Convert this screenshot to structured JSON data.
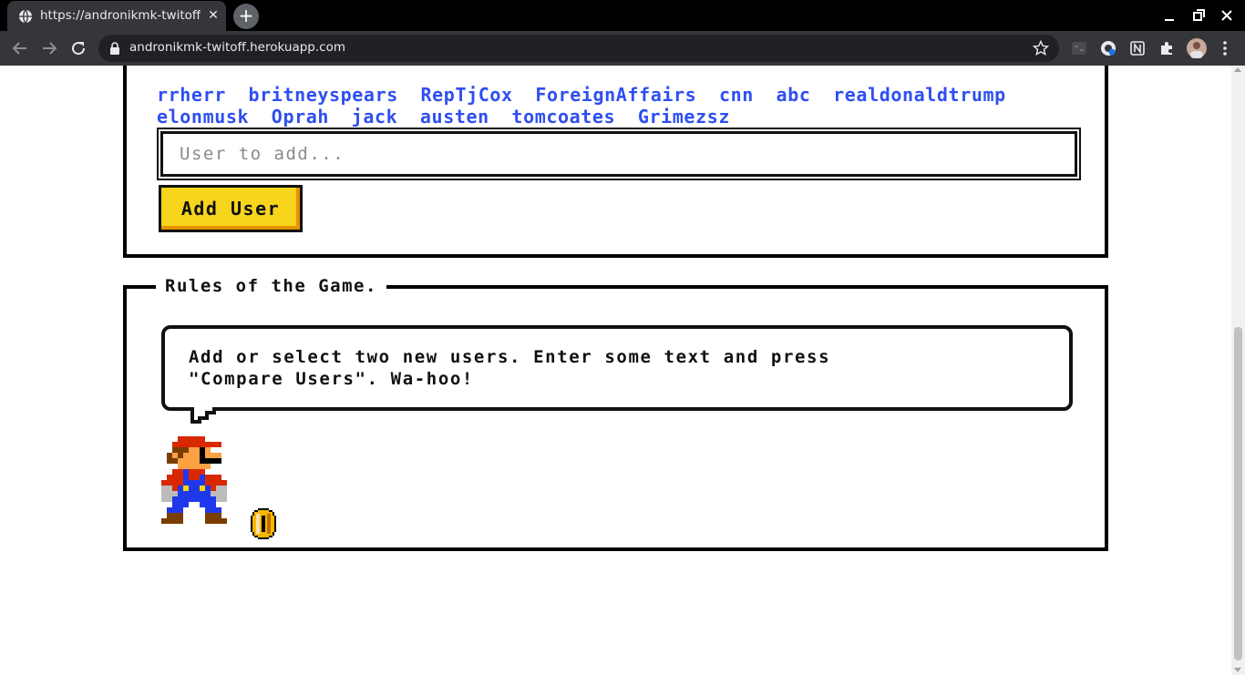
{
  "browser": {
    "tab_title": "https://andronikmk-twitoff.herokuapp.com",
    "url": "andronikmk-twitoff.herokuapp.com"
  },
  "users": {
    "list": [
      "rrherr",
      "britneyspears",
      "RepTjCox",
      "ForeignAffairs",
      "cnn",
      "abc",
      "realdonaldtrump",
      "elonmusk",
      "Oprah",
      "jack",
      "austen",
      "tomcoates",
      "Grimezsz"
    ],
    "input_placeholder": "User to add...",
    "add_button": "Add User"
  },
  "rules": {
    "title": "Rules of the Game.",
    "text_line1": "Add or select two new users. Enter some text and press",
    "text_line2": "\"Compare Users\". Wa-hoo!"
  },
  "colors": {
    "link": "#2e4ff0",
    "button": "#f7d51d",
    "border": "#000000"
  }
}
